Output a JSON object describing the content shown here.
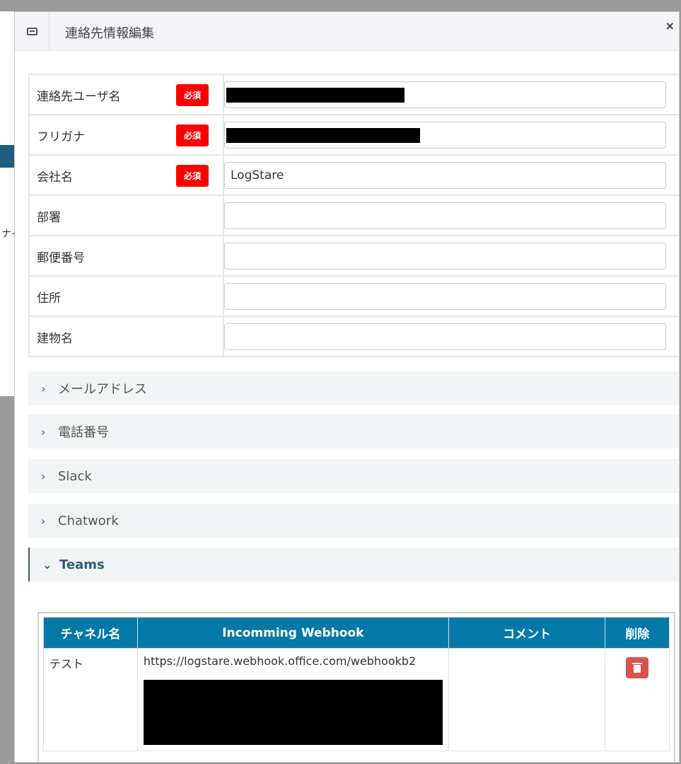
{
  "dialog": {
    "title": "連絡先情報編集",
    "icon": "window-icon",
    "close_label": "×"
  },
  "background": {
    "fragment_text": "ナイ"
  },
  "form": {
    "fields": [
      {
        "label": "連絡先ユーザ名",
        "required": true,
        "required_label": "必須",
        "value": "",
        "redacted": true
      },
      {
        "label": "フリガナ",
        "required": true,
        "required_label": "必須",
        "value": "",
        "redacted": true
      },
      {
        "label": "会社名",
        "required": true,
        "required_label": "必須",
        "value": "LogStare",
        "redacted": false
      },
      {
        "label": "部署",
        "required": false,
        "value": ""
      },
      {
        "label": "郵便番号",
        "required": false,
        "value": ""
      },
      {
        "label": "住所",
        "required": false,
        "value": ""
      },
      {
        "label": "建物名",
        "required": false,
        "value": ""
      }
    ]
  },
  "sections": [
    {
      "label": "メールアドレス",
      "expanded": false
    },
    {
      "label": "電話番号",
      "expanded": false
    },
    {
      "label": "Slack",
      "expanded": false
    },
    {
      "label": "Chatwork",
      "expanded": false
    },
    {
      "label": "Teams",
      "expanded": true
    }
  ],
  "teams": {
    "columns": [
      "チャネル名",
      "Incomming Webhook",
      "コメント",
      "削除"
    ],
    "rows": [
      {
        "channel": "テスト",
        "webhook": "https://logstare.webhook.office.com/webhookb2",
        "comment": "",
        "delete_icon": "trash-icon"
      }
    ]
  },
  "colors": {
    "required_badge": "#ff0000",
    "table_header": "#0479a8",
    "delete_button": "#d9534f",
    "accordion_active": "#2d5f73"
  }
}
